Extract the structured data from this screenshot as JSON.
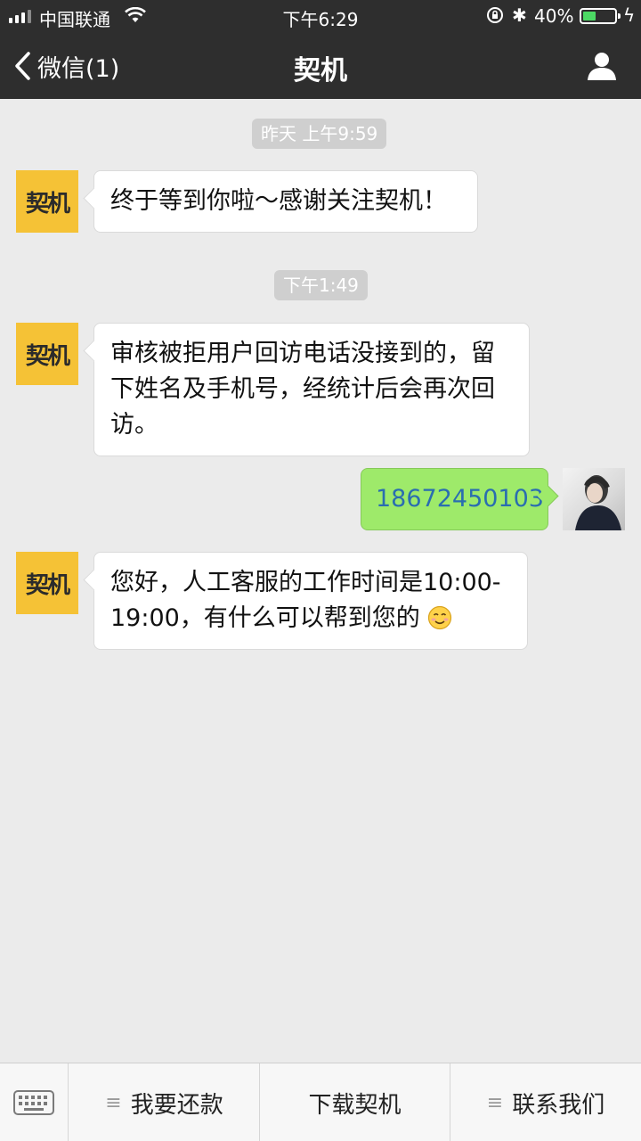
{
  "status_bar": {
    "carrier": "中国联通",
    "time": "下午6:29",
    "battery_percent_label": "40%",
    "battery_level": 0.4,
    "icons": [
      "signal-icon",
      "wifi-icon",
      "orientation-lock-icon",
      "bluetooth-icon",
      "battery-icon",
      "charging-icon"
    ]
  },
  "nav": {
    "back_label": "微信(1)",
    "title": "契机"
  },
  "chat": {
    "timestamps": [
      "昨天 上午9:59",
      "下午1:49"
    ],
    "bot_avatar_text": "契机",
    "messages": [
      {
        "from": "bot",
        "text": "终于等到你啦～感谢关注契机！"
      },
      {
        "from": "bot",
        "text": "审核被拒用户回访电话没接到的，留下姓名及手机号，经统计后会再次回访。"
      },
      {
        "from": "me",
        "text": "18672450103"
      },
      {
        "from": "bot",
        "text": "您好，人工客服的工作时间是10:00-19:00，有什么可以帮到您的",
        "emoji": "smile-emoji"
      }
    ]
  },
  "bottom_menu": {
    "items": [
      "我要还款",
      "下载契机",
      "联系我们"
    ]
  },
  "colors": {
    "nav_bg": "#2e2e2e",
    "chat_bg": "#ebebeb",
    "sent_bubble": "#9eea6a",
    "logo_yellow": "#f5c236",
    "link_blue": "#2a6db0"
  }
}
